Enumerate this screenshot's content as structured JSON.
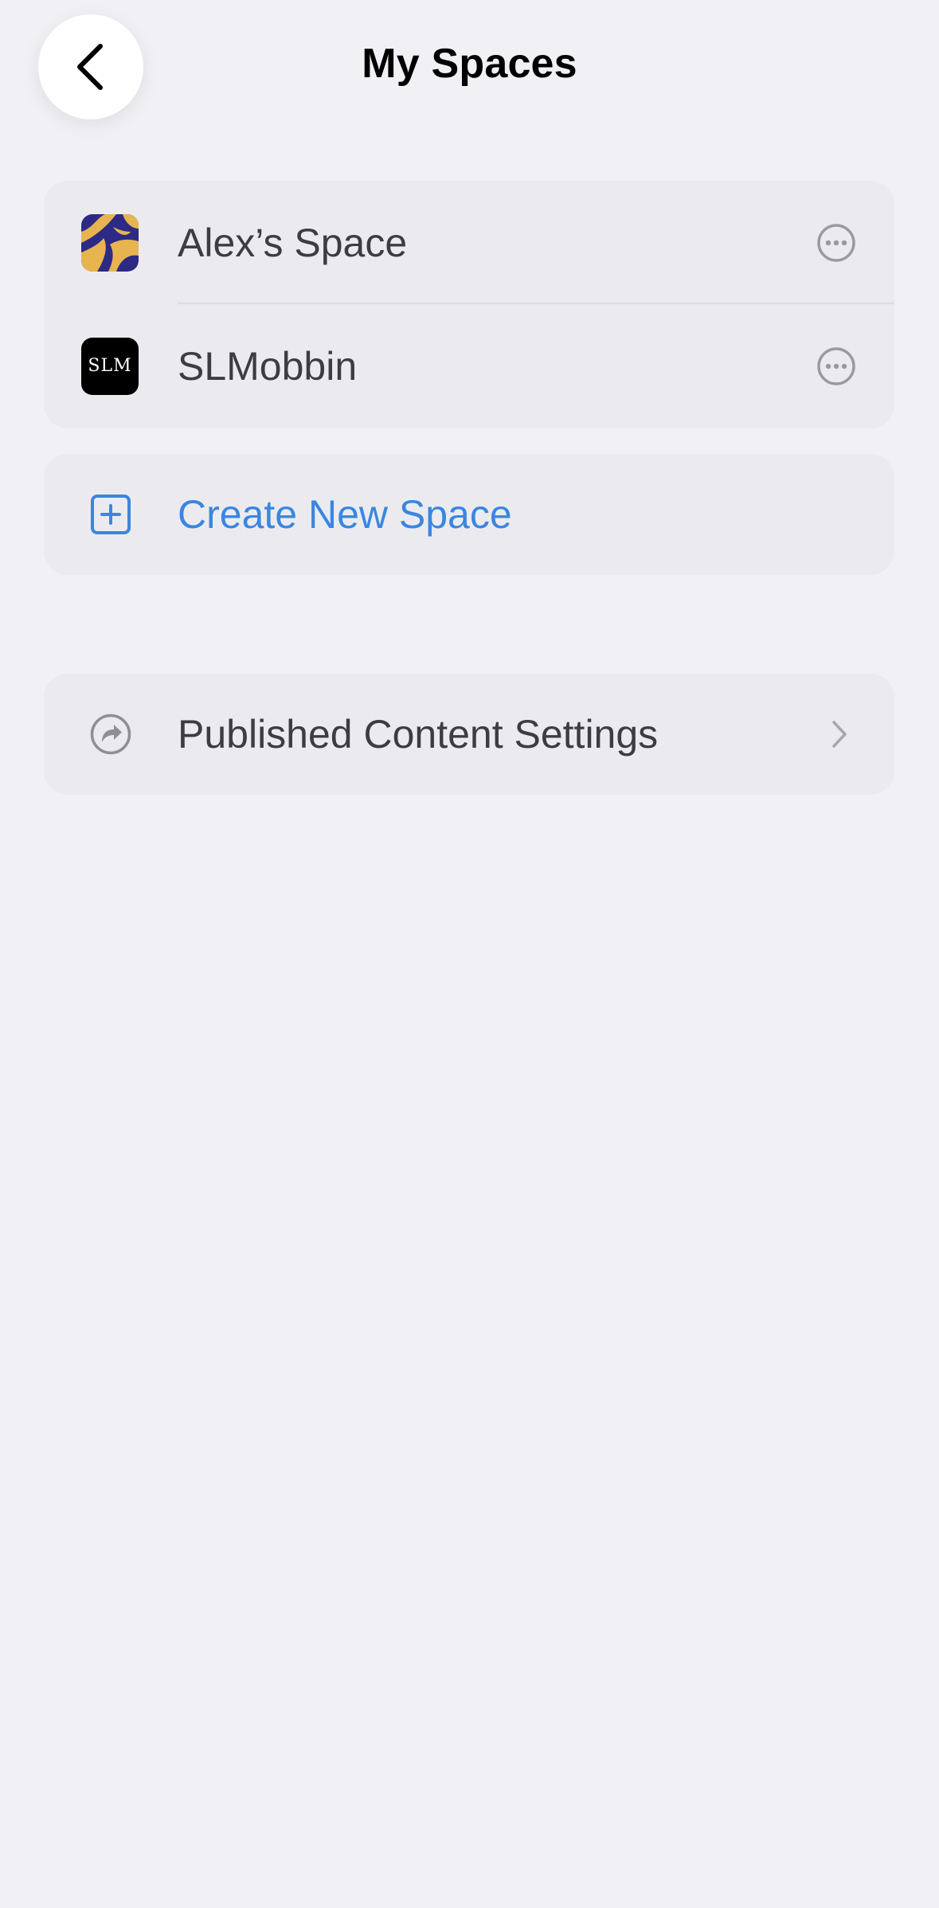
{
  "header": {
    "title": "My Spaces",
    "back_icon": "chevron-left-icon"
  },
  "spaces": [
    {
      "label": "Alex’s Space",
      "icon": "alex-space-logo",
      "more_icon": "ellipsis-circle-icon"
    },
    {
      "label": "SLMobbin",
      "icon_text": "SLM",
      "more_icon": "ellipsis-circle-icon"
    }
  ],
  "create": {
    "label": "Create New Space",
    "icon": "plus-square-icon",
    "color": "#3a86e0"
  },
  "settings": {
    "label": "Published Content Settings",
    "icon": "share-arrow-circle-icon",
    "chevron": "chevron-right-icon"
  },
  "colors": {
    "background": "#f1f1f5",
    "card": "#ebebef",
    "text": "#3c3c43",
    "accent": "#3a86e0",
    "alex_icon_gold": "#e8b450",
    "alex_icon_navy": "#2c2a84"
  }
}
